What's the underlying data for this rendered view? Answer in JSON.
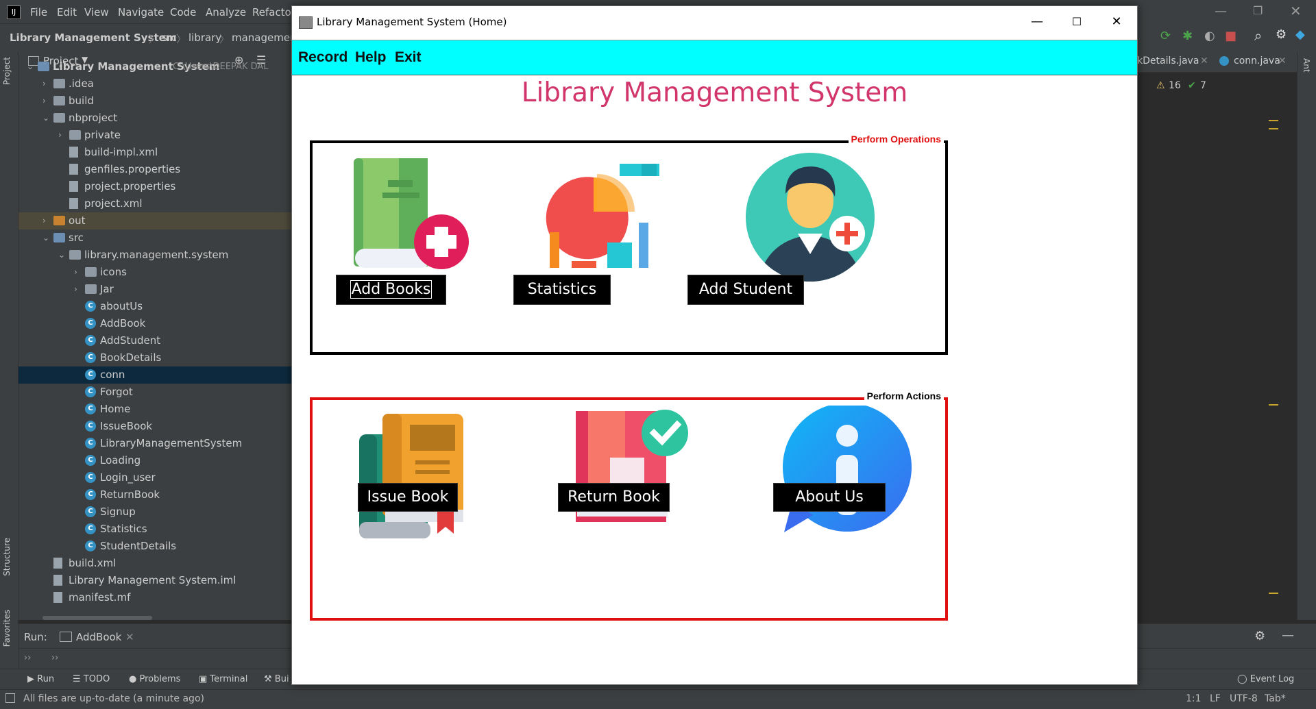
{
  "ide": {
    "menu": [
      "File",
      "Edit",
      "View",
      "Navigate",
      "Code",
      "Analyze",
      "Refactor"
    ],
    "breadcrumb": [
      "Library Management System",
      "src",
      "library",
      "management"
    ],
    "project_label": "Project",
    "tree": [
      {
        "name": "Library Management System",
        "path": "C:\\Users\\DEEPAK DAL",
        "depth": 0,
        "type": "folder-blue",
        "expanded": true
      },
      {
        "name": ".idea",
        "depth": 1,
        "type": "folder",
        "expanded": false
      },
      {
        "name": "build",
        "depth": 1,
        "type": "folder",
        "expanded": false
      },
      {
        "name": "nbproject",
        "depth": 1,
        "type": "folder",
        "expanded": true
      },
      {
        "name": "private",
        "depth": 2,
        "type": "folder",
        "expanded": false
      },
      {
        "name": "build-impl.xml",
        "depth": 2,
        "type": "file"
      },
      {
        "name": "genfiles.properties",
        "depth": 2,
        "type": "file"
      },
      {
        "name": "project.properties",
        "depth": 2,
        "type": "file"
      },
      {
        "name": "project.xml",
        "depth": 2,
        "type": "file"
      },
      {
        "name": "out",
        "depth": 1,
        "type": "folder-orange",
        "expanded": false
      },
      {
        "name": "src",
        "depth": 1,
        "type": "folder-blue",
        "expanded": true
      },
      {
        "name": "library.management.system",
        "depth": 2,
        "type": "folder",
        "expanded": true
      },
      {
        "name": "icons",
        "depth": 3,
        "type": "folder",
        "expanded": false
      },
      {
        "name": "Jar",
        "depth": 3,
        "type": "folder",
        "expanded": false
      },
      {
        "name": "aboutUs",
        "depth": 3,
        "type": "class"
      },
      {
        "name": "AddBook",
        "depth": 3,
        "type": "class"
      },
      {
        "name": "AddStudent",
        "depth": 3,
        "type": "class"
      },
      {
        "name": "BookDetails",
        "depth": 3,
        "type": "class"
      },
      {
        "name": "conn",
        "depth": 3,
        "type": "class"
      },
      {
        "name": "Forgot",
        "depth": 3,
        "type": "class"
      },
      {
        "name": "Home",
        "depth": 3,
        "type": "class"
      },
      {
        "name": "IssueBook",
        "depth": 3,
        "type": "class"
      },
      {
        "name": "LibraryManagementSystem",
        "depth": 3,
        "type": "class"
      },
      {
        "name": "Loading",
        "depth": 3,
        "type": "class"
      },
      {
        "name": "Login_user",
        "depth": 3,
        "type": "class"
      },
      {
        "name": "ReturnBook",
        "depth": 3,
        "type": "class"
      },
      {
        "name": "Signup",
        "depth": 3,
        "type": "class"
      },
      {
        "name": "Statistics",
        "depth": 3,
        "type": "class"
      },
      {
        "name": "StudentDetails",
        "depth": 3,
        "type": "class"
      },
      {
        "name": "build.xml",
        "depth": 1,
        "type": "file"
      },
      {
        "name": "Library Management System.iml",
        "depth": 1,
        "type": "file"
      },
      {
        "name": "manifest.mf",
        "depth": 1,
        "type": "file"
      }
    ],
    "left_tabs": {
      "project": "Project",
      "structure": "Structure",
      "favorites": "Favorites"
    },
    "run_label": "Run:",
    "run_tab": "AddBook",
    "tool_tabs": [
      "Run",
      "TODO",
      "Problems",
      "Terminal",
      "Bui"
    ],
    "event_log": "Event Log",
    "status_text": "All files are up-to-date (a minute ago)",
    "status_right": {
      "pos": "1:1",
      "lf": "LF",
      "enc": "UTF-8",
      "tab": "Tab*"
    },
    "editor_tabs": [
      "kDetails.java",
      "conn.java"
    ],
    "warnings": "16",
    "oks": "7",
    "right_tab": "Ant"
  },
  "app": {
    "title": "Library Management System (Home)",
    "menu": [
      "Record",
      "Help",
      "Exit"
    ],
    "heading": "Library Management System",
    "operations": {
      "group_title": "Perform Operations",
      "group_color": "#000000",
      "buttons": [
        "Add Books",
        "Statistics",
        "Add Student"
      ]
    },
    "actions": {
      "group_title": "Perform Actions",
      "group_color": "#e01010",
      "buttons": [
        "Issue Book",
        "Return Book",
        "About Us"
      ]
    },
    "colors": {
      "menubar": "#00ffff",
      "heading": "#d1356b",
      "button_bg": "#000000",
      "button_text": "#ffffff"
    }
  }
}
